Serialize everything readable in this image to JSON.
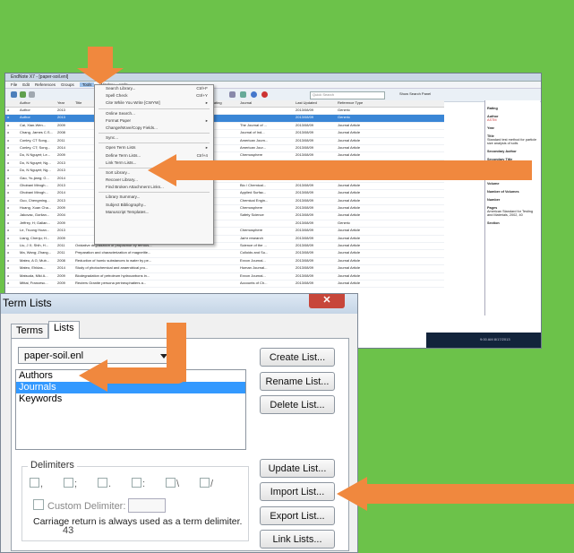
{
  "endnote": {
    "window_title": "EndNote X7 - [paper-soil.enl]",
    "menubar": [
      "File",
      "Edit",
      "References",
      "Groups",
      "Tools",
      "Window",
      "Help"
    ],
    "active_menu": "Tools",
    "search_placeholder": "Quick Search",
    "show_search_panel": "Show Search Panel",
    "columns": [
      "",
      "Author",
      "Year",
      "Title",
      "Rating",
      "Journal",
      "Last Updated",
      "Reference Type"
    ],
    "rows": [
      [
        "o",
        "Author",
        "2013",
        "",
        "",
        "",
        "2013/08/09",
        "Generic"
      ],
      [
        "o",
        "Author",
        "2013",
        "",
        "",
        "",
        "2013/08/09",
        "Generic"
      ],
      [
        "o",
        "Cai, Xian-Wen...",
        "2009",
        "",
        "",
        "The Journal of ...",
        "2013/08/09",
        "Journal Article"
      ],
      [
        "o",
        "Chang, James C.S...",
        "2008",
        "",
        "",
        "Journal of Ind...",
        "2013/08/09",
        "Journal Article"
      ],
      [
        "o",
        "Conley, CT Song...",
        "2011",
        "",
        "",
        "American Journ...",
        "2013/08/09",
        "Journal Article"
      ],
      [
        "o",
        "Conley, CT; Song...",
        "2014",
        "",
        "",
        "American Jour...",
        "2013/08/09",
        "Journal Article"
      ],
      [
        "o",
        "Do, N Nguyet; Le...",
        "2009",
        "",
        "",
        "Chemosphere",
        "2013/08/09",
        "Journal Article"
      ],
      [
        "o",
        "Do, N Nguyet; Ng...",
        "2013",
        "",
        "",
        "",
        "2013/08/09",
        "Journal Article"
      ],
      [
        "o",
        "Do, N Nguyet; Ng...",
        "2013",
        "",
        "",
        "",
        "2013/08/09",
        "Journal Article"
      ],
      [
        "o",
        "Gao, Yu-jiang; G...",
        "2014",
        "",
        "",
        "Chemical Engin...",
        "2013/08/09",
        "Journal Article"
      ],
      [
        "o",
        "Ghobani Mirogh...",
        "2013",
        "",
        "",
        "Bio / Chemical...",
        "2013/08/09",
        "Journal Article"
      ],
      [
        "o",
        "Ghobani Mirogh...",
        "2014",
        "",
        "",
        "Applied Surfac...",
        "2013/08/09",
        "Journal Article"
      ],
      [
        "o",
        "Guo, Chengming...",
        "2013",
        "",
        "",
        "Chemical Engin...",
        "2013/08/09",
        "Journal Article"
      ],
      [
        "o",
        "Huang, Xuan Cha...",
        "2009",
        "",
        "",
        "Chemosphere",
        "2013/08/09",
        "Journal Article"
      ],
      [
        "o",
        "Jakovac, Gorlian...",
        "2004",
        "",
        "",
        "Safety Science",
        "2013/08/09",
        "Journal Article"
      ],
      [
        "o",
        "Jeffrey, H; Gallan...",
        "2009",
        "",
        "",
        "",
        "2013/08/09",
        "Generic"
      ],
      [
        "o",
        "Le, Truong Hoan...",
        "2013",
        "",
        "",
        "Chemosphere",
        "2013/08/09",
        "Journal Article"
      ],
      [
        "o",
        "Liang, Chenju; H...",
        "2009",
        "",
        "",
        "Jarhr research",
        "2013/08/09",
        "Journal Article"
      ],
      [
        "o",
        "Liu, J X; Shih, H...",
        "2011",
        "Oxidative degradation of propachlor by ferrous...",
        "",
        "Science of the ...",
        "2013/08/09",
        "Journal Article"
      ],
      [
        "o",
        "Ma, Wang; Zhang...",
        "2011",
        "Preparation and characterization of magnetite...",
        "",
        "Colloids and Su...",
        "2013/08/09",
        "Journal Article"
      ],
      [
        "o",
        "Mateo, A G; Mub...",
        "2008",
        "Reduction of humic substances to water by pe...",
        "",
        "Exxon Journal...",
        "2013/08/09",
        "Journal Article"
      ],
      [
        "o",
        "Mateo, Ehldas...",
        "2014",
        "Study of photochemical and anaerobical pro...",
        "",
        "Human Journal...",
        "2013/08/09",
        "Journal Article"
      ],
      [
        "o",
        "Matsuda, Miki A...",
        "2009",
        "Biodegradation of petroleum hydrocarbons in...",
        "",
        "Exxon Journal...",
        "2013/08/09",
        "Journal Article"
      ],
      [
        "o",
        "Mittal, Francesc...",
        "2009",
        "Reuters Granite persona perineuphatiers a...",
        "",
        "Accounts of Ch...",
        "2013/08/09",
        "Journal Article"
      ]
    ],
    "right_pane": {
      "fields": [
        "Rating",
        "Author",
        "Year",
        "Title",
        "Secondary Author",
        "Secondary Title",
        "Place Published",
        "Publisher",
        "Volume",
        "Number of Volumes",
        "Number",
        "Pages",
        "Section"
      ],
      "author_value": "ASTM",
      "title_value": "Standard test method for particle size analysis of soils",
      "pages_value": "American Standard for Testing and Materials, 2002, 40"
    },
    "taskbar_clock": "9:00 AM 8/17/2013"
  },
  "tools_menu": {
    "items": [
      {
        "label": "Search Library...",
        "shortcut": "Ctrl+F"
      },
      {
        "label": "Spell Check",
        "shortcut": "Ctrl+Y"
      },
      {
        "label": "Cite While You Write [CWYW]",
        "shortcut": "▸"
      },
      {
        "label": "Online Search...",
        "shortcut": ""
      },
      {
        "label": "Format Paper",
        "shortcut": "▸"
      },
      {
        "label": "Change/Move/Copy Fields...",
        "shortcut": ""
      },
      {
        "label": "Sync...",
        "shortcut": ""
      },
      {
        "label": "Open Term Lists",
        "shortcut": "▸"
      },
      {
        "label": "Define Term Lists...",
        "shortcut": "Ctrl+4"
      },
      {
        "label": "Link Term Lists...",
        "shortcut": "Ctrl+3"
      },
      {
        "label": "Sort Library...",
        "shortcut": ""
      },
      {
        "label": "Recover Library...",
        "shortcut": ""
      },
      {
        "label": "Find Broken Attachment Links...",
        "shortcut": ""
      },
      {
        "label": "Library Summary...",
        "shortcut": ""
      },
      {
        "label": "Subject Bibliography...",
        "shortcut": ""
      },
      {
        "label": "Manuscript Templates...",
        "shortcut": ""
      }
    ]
  },
  "term_lists_dialog": {
    "title": "Term Lists",
    "close": "✕",
    "tabs": [
      "Terms",
      "Lists"
    ],
    "library": "paper-soil.enl",
    "lists": [
      "Authors",
      "Journals",
      "Keywords"
    ],
    "selected_list": "Journals",
    "buttons": {
      "create": "Create List...",
      "rename": "Rename List...",
      "delete": "Delete List...",
      "update": "Update List...",
      "import": "Import List...",
      "export": "Export List...",
      "link": "Link Lists..."
    },
    "delimiters_label": "Delimiters",
    "delimiters": [
      ",",
      ";",
      ".",
      ":",
      "\\",
      "/"
    ],
    "custom_delimiter_label": "Custom Delimiter:",
    "note": "Carriage return is always used as a term delimiter."
  },
  "slide_page_number": "43",
  "colors": {
    "background": "#6cc24a",
    "arrow": "#f0883e",
    "selection": "#3399ff"
  }
}
